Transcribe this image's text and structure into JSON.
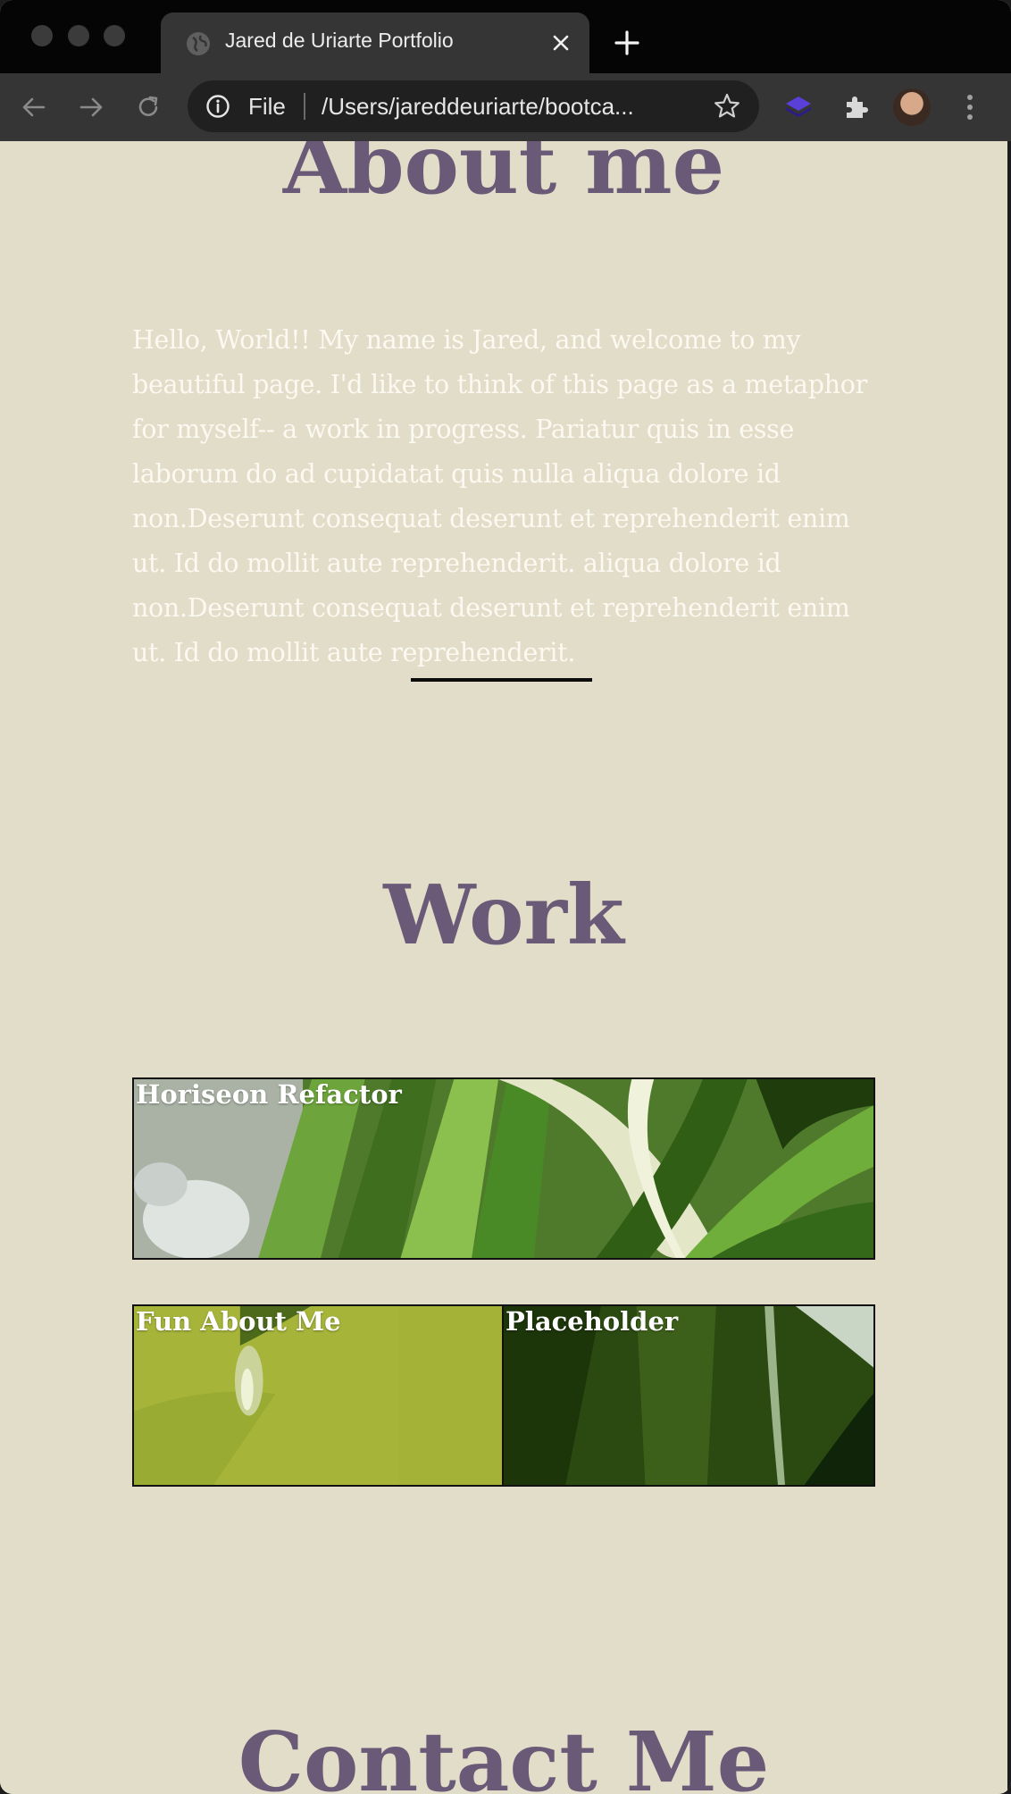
{
  "browser": {
    "tab_title": "Jared de Uriarte Portfolio",
    "address_scheme": "File",
    "address_url": "/Users/jareddeuriarte/bootca..."
  },
  "about": {
    "title": "About me",
    "text": "Hello, World!! My name is Jared, and welcome to my beautiful page. I'd like to think of this page as a metaphor for myself-- a work in progress. Pariatur quis in esse laborum do ad cupidatat quis nulla aliqua dolore id non.Deserunt consequat deserunt et reprehenderit enim ut. Id do mollit aute reprehenderit. aliqua dolore id non.Deserunt consequat deserunt et reprehenderit enim ut. Id do mollit aute reprehenderit."
  },
  "work": {
    "title": "Work",
    "cards": [
      {
        "label": "Horiseon Refactor"
      },
      {
        "label": "Fun About Me"
      },
      {
        "label": "Placeholder"
      }
    ]
  },
  "contact": {
    "title": "Contact Me"
  },
  "colors": {
    "page_background": "#e2ddc8",
    "heading": "#6a5a78",
    "body_text": "#fbf9f1"
  }
}
